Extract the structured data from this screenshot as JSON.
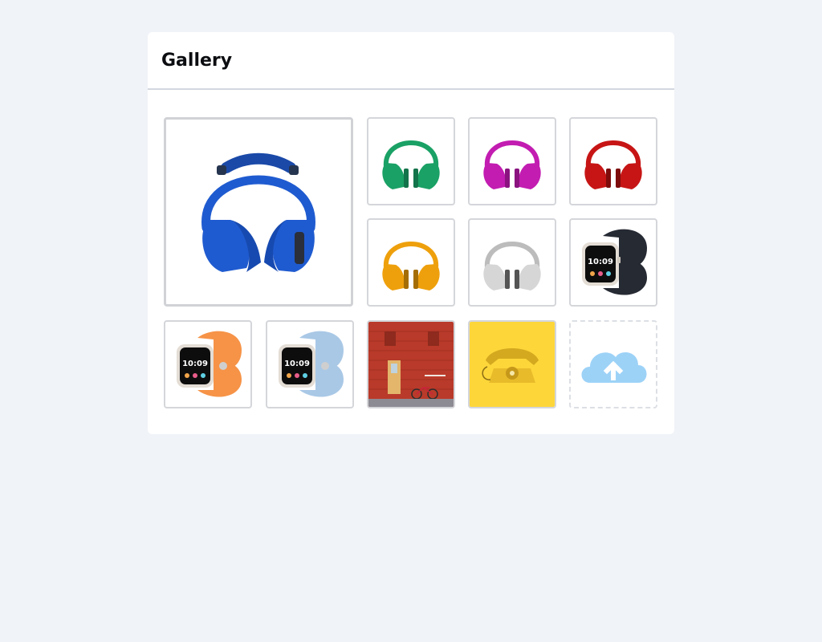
{
  "gallery": {
    "title": "Gallery",
    "main_image": {
      "icon": "blue-headphones",
      "color": "#1f5bd0"
    },
    "thumbnails": [
      {
        "icon": "green-headphones",
        "color": "#1aa165"
      },
      {
        "icon": "magenta-headphones",
        "color": "#c21cb1"
      },
      {
        "icon": "red-headphones",
        "color": "#c71515"
      },
      {
        "icon": "orange-headphones",
        "color": "#eea00c"
      },
      {
        "icon": "silver-headphones",
        "color": "#bcbcbc"
      },
      {
        "icon": "midnight-watch",
        "color": "#262a33"
      },
      {
        "icon": "orange-watch",
        "color": "#f69347"
      },
      {
        "icon": "blue-watch",
        "color": "#a9c8e6"
      },
      {
        "icon": "red-brick-door-photo",
        "color": "#b93a2a"
      },
      {
        "icon": "yellow-phone-photo",
        "color": "#fdd63a"
      }
    ],
    "upload": {
      "icon": "cloud-upload-icon",
      "color": "#9dd2f7"
    }
  }
}
